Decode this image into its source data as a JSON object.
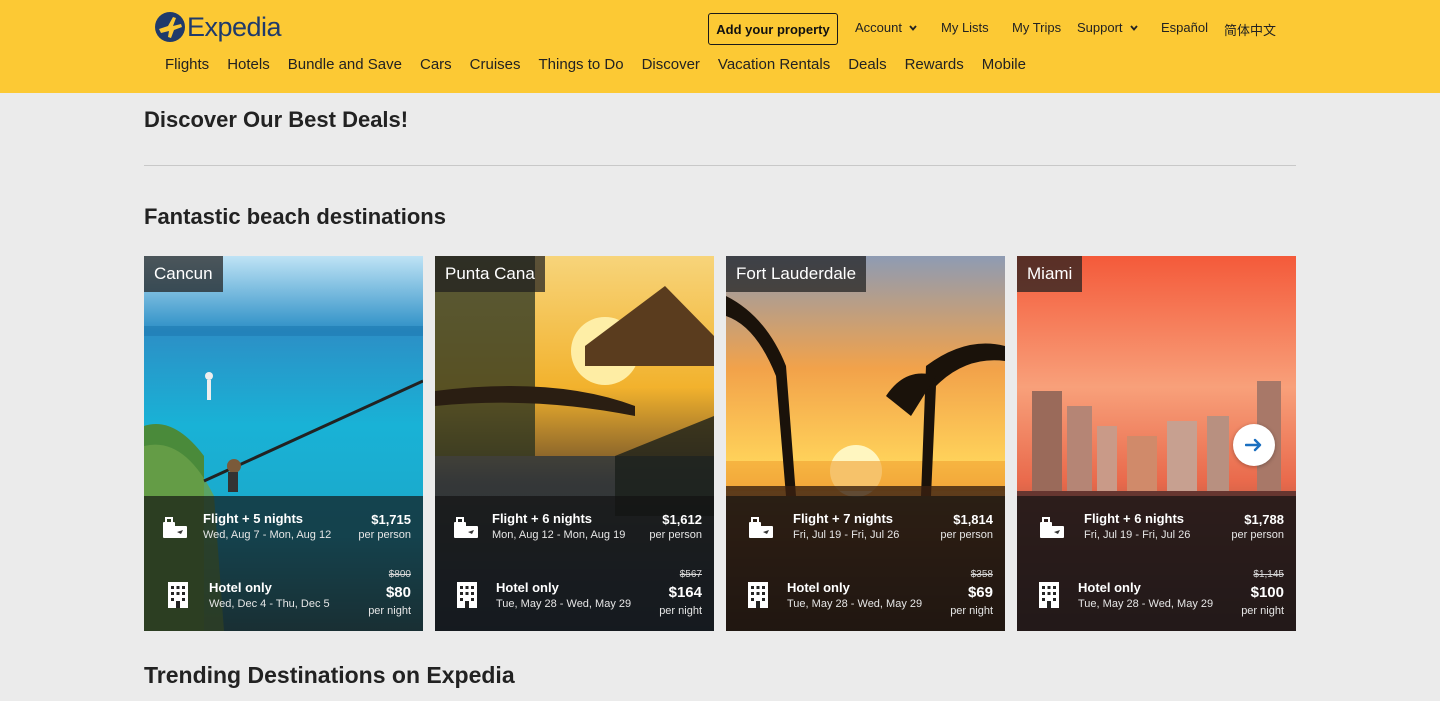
{
  "header": {
    "brand": "Expedia",
    "add_property": "Add your property",
    "top_links": {
      "account": "Account",
      "my_lists": "My Lists",
      "my_trips": "My Trips",
      "support": "Support",
      "espanol": "Español",
      "chinese": "简体中文"
    },
    "nav": [
      "Flights",
      "Hotels",
      "Bundle and Save",
      "Cars",
      "Cruises",
      "Things to Do",
      "Discover",
      "Vacation Rentals",
      "Deals",
      "Rewards",
      "Mobile"
    ]
  },
  "main": {
    "best_deals_title": "Discover Our Best Deals!",
    "beach_title": "Fantastic beach destinations",
    "trending_title": "Trending Destinations on Expedia"
  },
  "cards": [
    {
      "city": "Cancun",
      "package_title": "Flight + 5 nights",
      "package_dates": "Wed, Aug 7 - Mon, Aug 12",
      "package_price": "$1,715",
      "package_unit": "per person",
      "hotel_title": "Hotel only",
      "hotel_dates": "Wed, Dec 4 - Thu, Dec 5",
      "hotel_old_price": "$800",
      "hotel_price": "$80",
      "hotel_unit": "per night"
    },
    {
      "city": "Punta Cana",
      "package_title": "Flight + 6 nights",
      "package_dates": "Mon, Aug 12 - Mon, Aug 19",
      "package_price": "$1,612",
      "package_unit": "per person",
      "hotel_title": "Hotel only",
      "hotel_dates": "Tue, May 28 - Wed, May 29",
      "hotel_old_price": "$567",
      "hotel_price": "$164",
      "hotel_unit": "per night"
    },
    {
      "city": "Fort Lauderdale",
      "package_title": "Flight + 7 nights",
      "package_dates": "Fri, Jul 19 - Fri, Jul 26",
      "package_price": "$1,814",
      "package_unit": "per person",
      "hotel_title": "Hotel only",
      "hotel_dates": "Tue, May 28 - Wed, May 29",
      "hotel_old_price": "$358",
      "hotel_price": "$69",
      "hotel_unit": "per night"
    },
    {
      "city": "Miami",
      "package_title": "Flight + 6 nights",
      "package_dates": "Fri, Jul 19 - Fri, Jul 26",
      "package_price": "$1,788",
      "package_unit": "per person",
      "hotel_title": "Hotel only",
      "hotel_dates": "Tue, May 28 - Wed, May 29",
      "hotel_old_price": "$1,145",
      "hotel_price": "$100",
      "hotel_unit": "per night"
    }
  ],
  "icons": {
    "brand_plane": "plane-logo-icon",
    "package": "luggage-plane-icon",
    "hotel": "building-icon",
    "carousel_next": "arrow-right-icon"
  },
  "colors": {
    "header_bg": "#fcc934",
    "brand_navy": "#1f3a6b",
    "page_bg": "#ebebeb",
    "accent_blue": "#1a6fc0"
  }
}
